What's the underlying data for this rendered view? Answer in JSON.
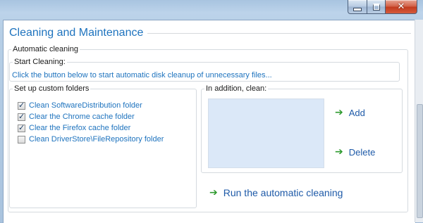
{
  "window": {
    "caption_buttons": {
      "minimize_icon": "minimize-icon",
      "maximize_icon": "maximize-icon",
      "close_glyph": "✕"
    }
  },
  "page": {
    "title": "Cleaning and Maintenance"
  },
  "automatic_cleaning": {
    "legend": "Automatic cleaning",
    "start_cleaning": {
      "legend": "Start Cleaning:",
      "info": "Click the button below to start automatic disk cleanup of unnecessary files..."
    },
    "custom_folders": {
      "legend": "Set up custom folders",
      "items": [
        {
          "label": "Clean SoftwareDistribution folder",
          "checked": true
        },
        {
          "label": "Clear the Chrome cache folder",
          "checked": true
        },
        {
          "label": "Clear the Firefox cache folder",
          "checked": true
        },
        {
          "label": "Clean DriverStore\\FileRepository folder",
          "checked": false
        }
      ]
    },
    "in_addition": {
      "legend": "In addition, clean:",
      "add_label": "Add",
      "delete_label": "Delete"
    },
    "run_label": "Run the automatic cleaning"
  },
  "colors": {
    "accent": "#1e73be",
    "link": "#1e5aa8",
    "arrow_green": "#2e9a2e",
    "list_bg": "#dbe8f8"
  }
}
